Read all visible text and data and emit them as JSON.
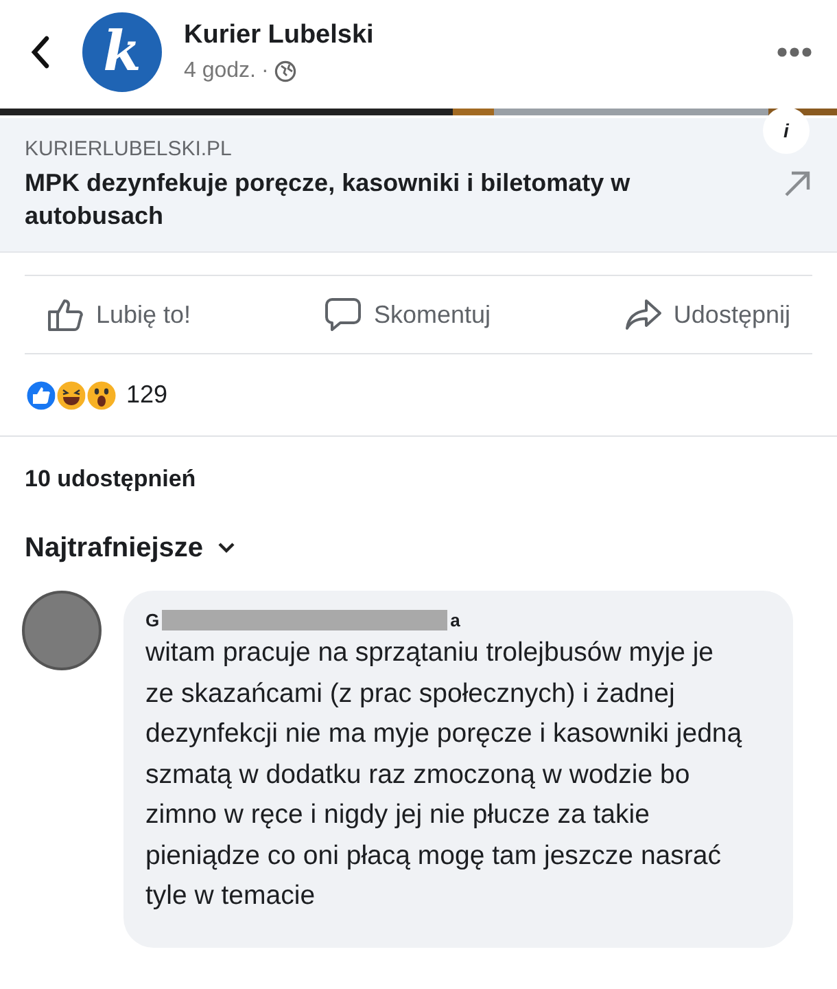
{
  "header": {
    "page_name": "Kurier Lubelski",
    "logo_letter": "k",
    "time": "4 godz.",
    "separator": "·"
  },
  "link_preview": {
    "kind": "picture",
    "domain": "KURIERLUBELSKI.PL",
    "title": "MPK dezynfekuje poręcze, kasowniki i biletomaty w autobusach",
    "info_glyph": "i"
  },
  "actions": [
    {
      "kind": "like",
      "label": "Lubię to!"
    },
    {
      "kind": "comment",
      "label": "Skomentuj"
    },
    {
      "kind": "share",
      "label": "Udostępnij"
    }
  ],
  "reactions": {
    "count": "129"
  },
  "shares": "10 udostępnień",
  "sort": {
    "label": "Najtrafniejsze"
  },
  "comment": {
    "author_start": "G",
    "author_redacted": true,
    "author_end": "a",
    "text": "witam pracuje na sprzątaniu trolejbusów myje je ze skazańcami (z prac społecznych) i żadnej dezynfekcji nie ma myje poręcze i kasowniki jedną szmatą w dodatku raz zmoczoną w wodzie bo zimno w ręce i nigdy jej nie płucze za takie pieniądze co oni płacą mogę tam jeszcze nasrać tyle w temacie"
  }
}
